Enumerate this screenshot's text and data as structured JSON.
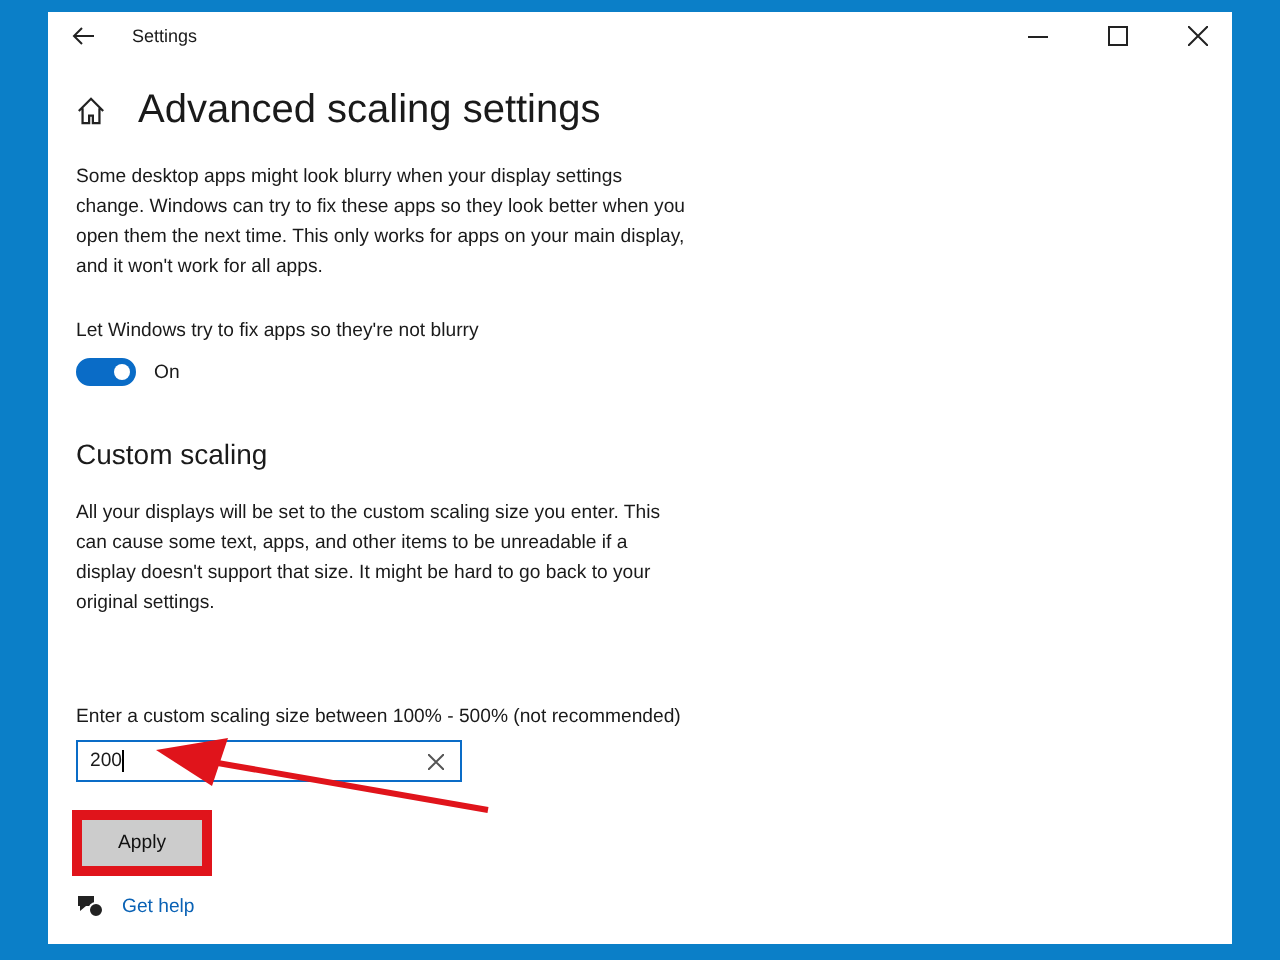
{
  "window": {
    "title": "Settings"
  },
  "page": {
    "title": "Advanced scaling settings"
  },
  "intro": "Some desktop apps might look blurry when your display settings change. Windows can try to fix these apps so they look better when you open them the next time. This only works for apps on your main display, and it won't work for all apps.",
  "fix_apps": {
    "label": "Let Windows try to fix apps so they're not blurry",
    "on": true,
    "state_text": "On"
  },
  "custom_scaling": {
    "heading": "Custom scaling",
    "description": "All your displays will be set to the custom scaling size you enter. This can cause some text, apps, and other items to be unreadable if a display doesn't support that size. It might be hard to go back to your original settings.",
    "field_label": "Enter a custom scaling size between 100% - 500% (not recommended)",
    "value": "200",
    "button": "Apply"
  },
  "help_link": "Get help"
}
